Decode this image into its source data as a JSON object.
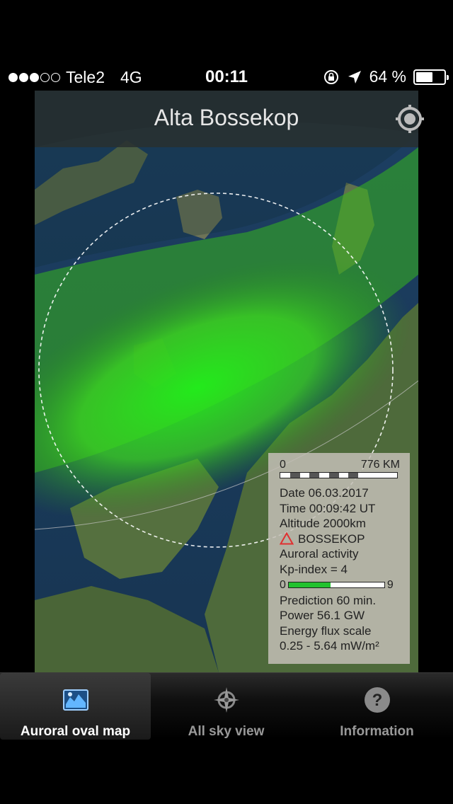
{
  "status_bar": {
    "carrier": "Tele2",
    "network": "4G",
    "time": "00:11",
    "battery_percent": "64 %",
    "battery_level": 0.64,
    "signal_bars_filled": 3,
    "signal_bars_total": 5
  },
  "header": {
    "title": "Alta Bossekop",
    "locate_icon": "location-target-icon"
  },
  "legend": {
    "scale_start": "0",
    "scale_end": "776 KM",
    "date": "Date  06.03.2017",
    "time": "Time 00:09:42 UT",
    "altitude": "Altitude 2000km",
    "station": "BOSSEKOP",
    "activity_label": "Auroral activity",
    "kp_index": "Kp-index = 4",
    "kp_min": "0",
    "kp_max": "9",
    "kp_fill_fraction": 0.44,
    "prediction": "Prediction 60 min.",
    "power": "Power 56.1 GW",
    "energy_label": "Energy flux scale",
    "energy_range": "0.25 - 5.64 mW/m²",
    "colors": {
      "kp_fill": "#22c22e",
      "warning": "#e03030"
    }
  },
  "tabs": [
    {
      "label": "Auroral oval map",
      "icon": "map-icon",
      "selected": true
    },
    {
      "label": "All sky view",
      "icon": "compass-icon",
      "selected": false
    },
    {
      "label": "Information",
      "icon": "question-icon",
      "selected": false
    }
  ]
}
